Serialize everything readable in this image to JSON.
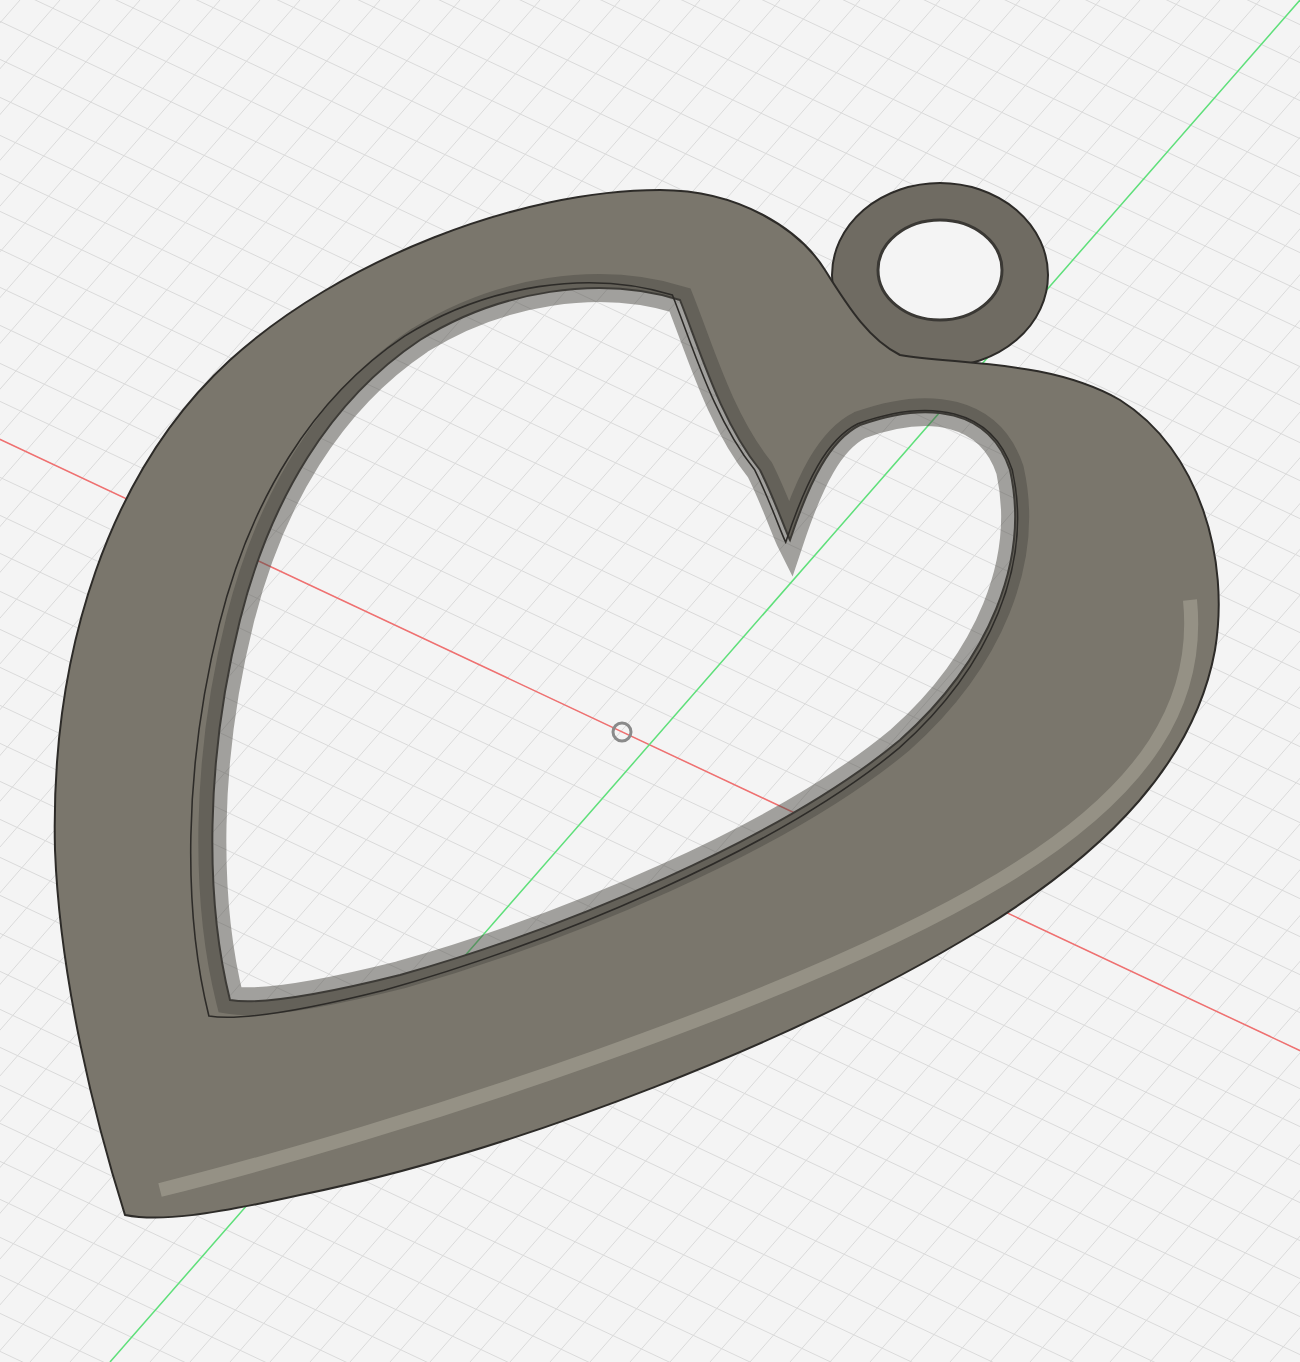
{
  "viewport": {
    "axes": [
      {
        "kind": "x",
        "color": "#f07070"
      },
      {
        "kind": "y",
        "color": "#5ee07a"
      }
    ]
  }
}
